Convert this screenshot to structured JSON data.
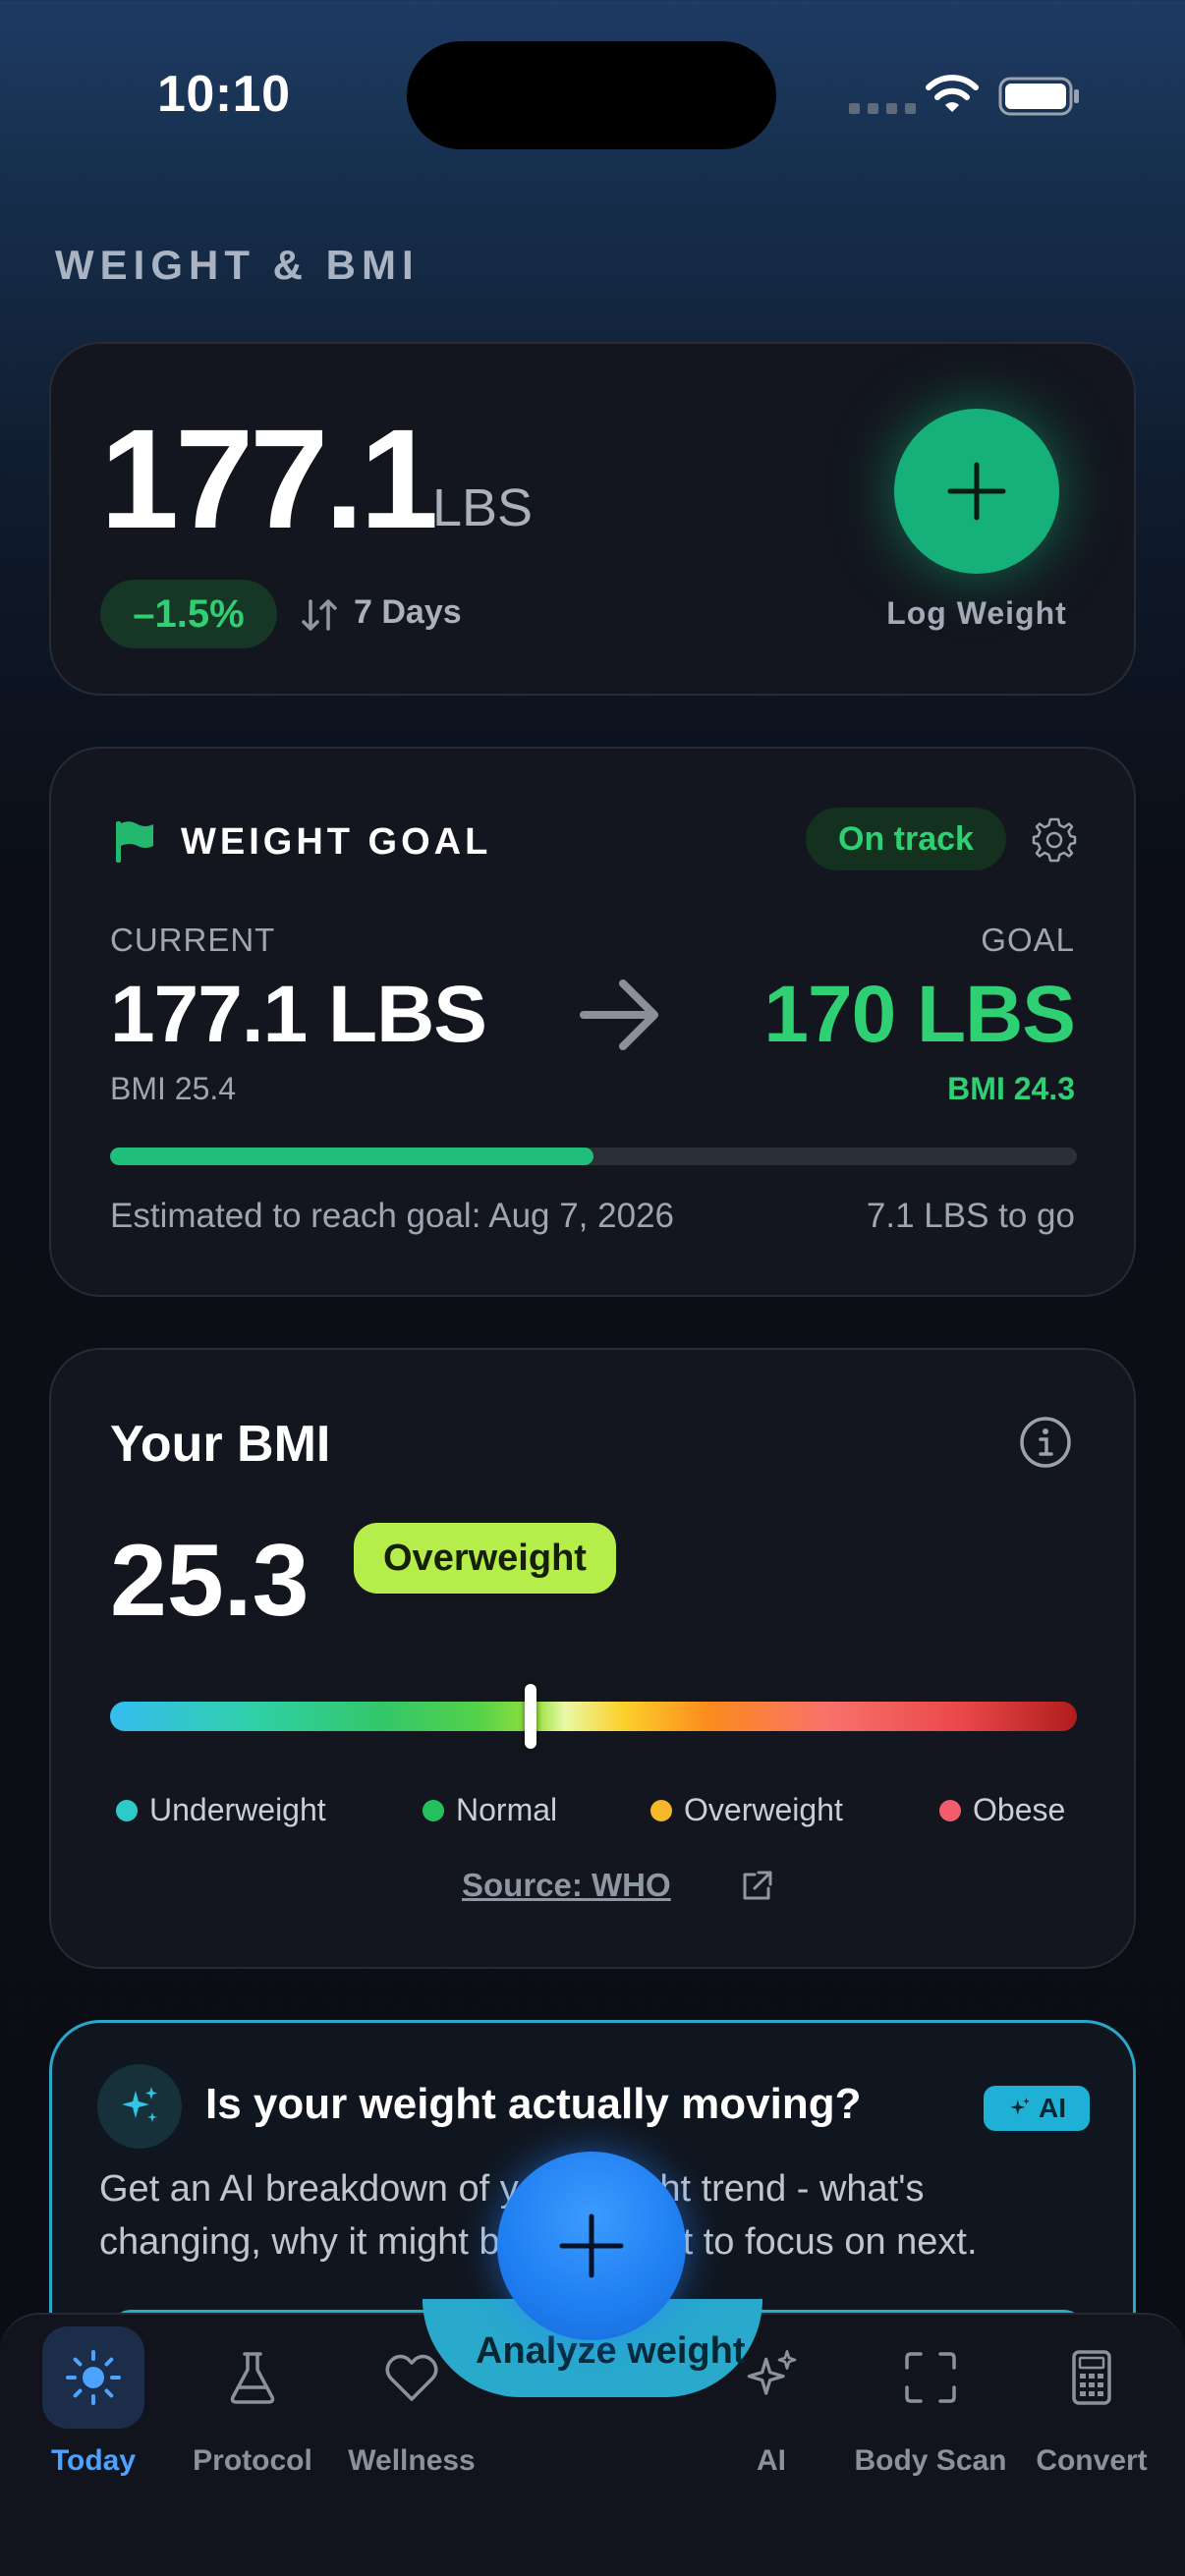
{
  "status_bar": {
    "time": "10:10"
  },
  "section_title": "WEIGHT & BMI",
  "weight_card": {
    "weight": "177.1",
    "unit": "LBS",
    "change": "–1.5%",
    "period": "7 Days",
    "log_label": "Log Weight"
  },
  "goal_card": {
    "title": "WEIGHT GOAL",
    "status": "On track",
    "current_label": "CURRENT",
    "goal_label": "GOAL",
    "current_value": "177.1 LBS",
    "goal_value": "170 LBS",
    "current_bmi": "BMI 25.4",
    "goal_bmi": "BMI 24.3",
    "progress_fraction": 0.5,
    "eta": "Estimated to reach goal: Aug 7, 2026",
    "to_go": "7.1 LBS to go"
  },
  "bmi_card": {
    "title": "Your BMI",
    "value": "25.3",
    "category": "Overweight",
    "marker_fraction": 0.435,
    "legend": [
      {
        "label": "Underweight",
        "color": "#2ec9c9"
      },
      {
        "label": "Normal",
        "color": "#25c05e"
      },
      {
        "label": "Overweight",
        "color": "#f5b82a"
      },
      {
        "label": "Obese",
        "color": "#f25c6b"
      }
    ],
    "source": "Source: WHO"
  },
  "ai_card": {
    "title": "Is your weight actually moving?",
    "badge": "AI",
    "description": "Get an AI breakdown of your weight trend - what's changing, why it might be, and what to focus on next.",
    "button_label": "Analyze weight"
  },
  "nav": {
    "items": [
      {
        "label": "Today",
        "icon": "sun-icon"
      },
      {
        "label": "Protocol",
        "icon": "flask-icon"
      },
      {
        "label": "Wellness",
        "icon": "heart-icon"
      },
      {
        "label": "AI",
        "icon": "sparkles-icon"
      },
      {
        "label": "Body Scan",
        "icon": "scan-icon"
      },
      {
        "label": "Convert",
        "icon": "calculator-icon"
      }
    ],
    "active": "Today"
  },
  "colors": {
    "accent_green": "#2fcf73",
    "accent_blue": "#4ba3ff",
    "ai_cyan": "#29a9cc"
  }
}
